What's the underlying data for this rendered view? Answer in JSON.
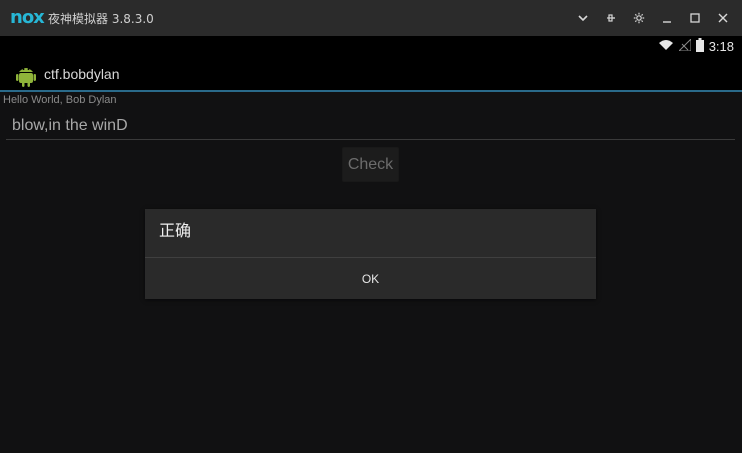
{
  "window": {
    "title": "夜神模拟器 3.8.3.0",
    "logo": "nox",
    "controls": [
      "chevron-down-icon",
      "pin-icon",
      "gear-icon",
      "minimize-icon",
      "maximize-icon",
      "close-icon"
    ]
  },
  "status_bar": {
    "time": "3:18"
  },
  "action_bar": {
    "app_title": "ctf.bobdylan"
  },
  "content": {
    "hello_text": "Hello World, Bob Dylan",
    "input_value": "blow,in the winD",
    "check_label": "Check"
  },
  "dialog": {
    "title": "正确",
    "ok_label": "OK"
  },
  "colors": {
    "accent": "#27b7d6",
    "actionbar_border": "#2a6a8a",
    "dialog_bg": "#2a2a2a"
  }
}
